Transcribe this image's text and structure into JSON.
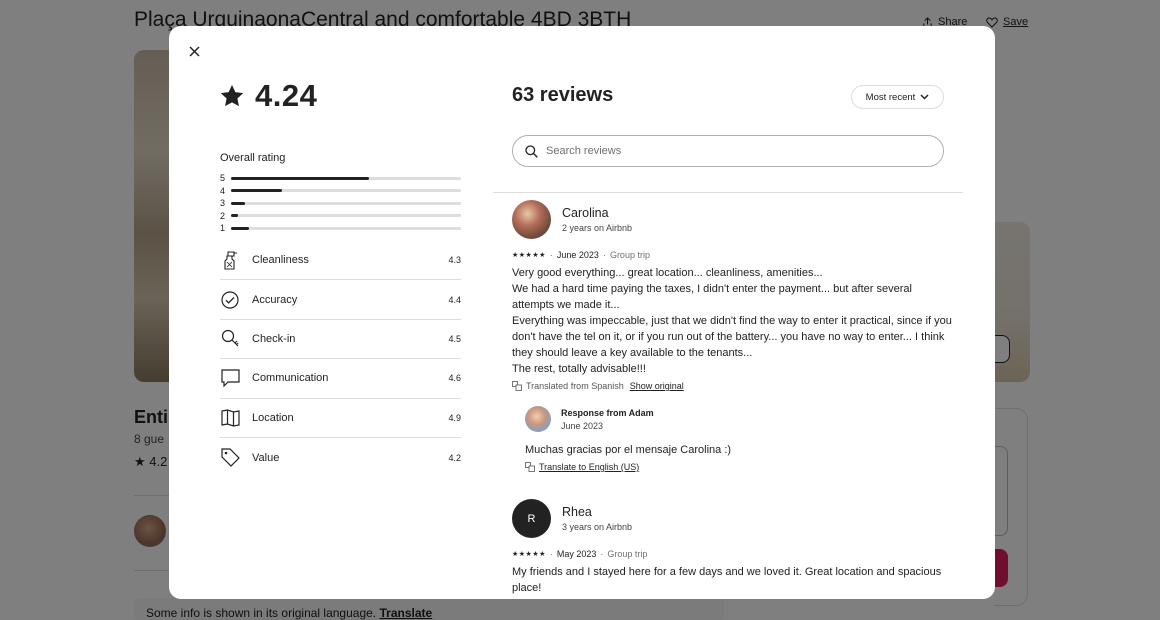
{
  "background": {
    "title": "Plaça UrquinaonaCentral and comfortable 4BD 3BTH",
    "share_label": "Share",
    "save_label": "Save",
    "listing_heading": "Enti",
    "guests_text": "8 gue",
    "rating_text": "★ 4.2",
    "translate_note": "Some info is shown in its original language.",
    "translate_link": "Translate"
  },
  "modal": {
    "rating": "4.24",
    "overall_label": "Overall rating",
    "distribution": [
      {
        "stars": "5",
        "fraction": 0.6
      },
      {
        "stars": "4",
        "fraction": 0.22
      },
      {
        "stars": "3",
        "fraction": 0.06
      },
      {
        "stars": "2",
        "fraction": 0.03
      },
      {
        "stars": "1",
        "fraction": 0.08
      }
    ],
    "categories": [
      {
        "label": "Cleanliness",
        "score": "4.3",
        "icon": "spray-bottle-icon"
      },
      {
        "label": "Accuracy",
        "score": "4.4",
        "icon": "check-circle-icon"
      },
      {
        "label": "Check-in",
        "score": "4.5",
        "icon": "key-icon"
      },
      {
        "label": "Communication",
        "score": "4.6",
        "icon": "chat-bubble-icon"
      },
      {
        "label": "Location",
        "score": "4.9",
        "icon": "map-icon"
      },
      {
        "label": "Value",
        "score": "4.2",
        "icon": "tag-icon"
      }
    ],
    "reviews_title": "63 reviews",
    "sort_label": "Most recent",
    "search_placeholder": "Search reviews",
    "reviews": [
      {
        "name": "Carolina",
        "subtitle": "2 years on Airbnb",
        "stars": "★★★★★",
        "date": "June 2023",
        "trip": "Group trip",
        "lines": [
          "Very good everything... great location... cleanliness, amenities...",
          "We had a hard time paying the taxes, I didn't enter the payment... but after several attempts we made it...",
          "Everything was impeccable, just that we didn't find the way to enter it practical, since if you don't have the tel on it, or if you run out of the battery... you have no way to enter... I think they should leave a key available to the tenants...",
          "The rest, totally advisable!!!"
        ],
        "translated_note": "Translated from Spanish",
        "show_original": "Show original",
        "response": {
          "from": "Response from Adam",
          "date": "June 2023",
          "text": "Muchas gracias por el mensaje Carolina :)",
          "translate": "Translate to English (US)"
        }
      },
      {
        "name": "Rhea",
        "initial": "R",
        "subtitle": "3 years on Airbnb",
        "stars": "★★★★★",
        "date": "May 2023",
        "trip": "Group trip",
        "lines": [
          "My friends and I stayed here for a few days and we loved it. Great location and spacious place!"
        ]
      }
    ]
  }
}
